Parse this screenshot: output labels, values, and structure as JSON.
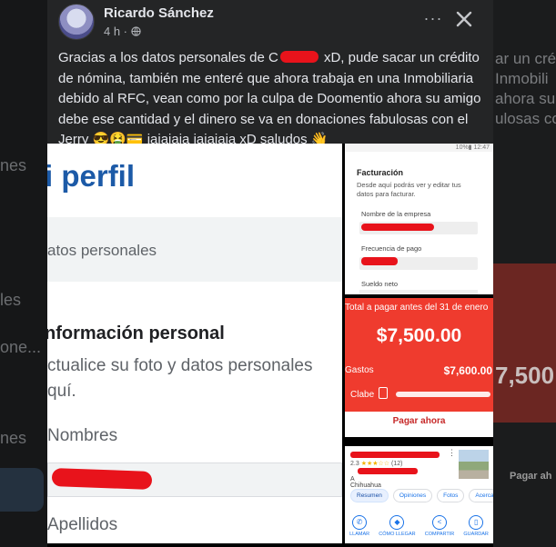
{
  "background": {
    "left_snippets": [
      "nes",
      "les",
      "one...",
      "nes"
    ],
    "right_snippets": [
      "ar un cré",
      "Inmobili",
      "ahora su",
      "ulosas co"
    ],
    "right_amount": "7,500",
    "right_pay": "Pagar ah"
  },
  "post": {
    "author": "Ricardo Sánchez",
    "time": "4 h ·",
    "more_label": "···",
    "text_before_redaction": "Gracias a los datos personales de C",
    "text_after_redaction": " xD, pude sacar un crédito de nómina, también me enteré que ahora trabaja en una Inmobiliaria debido al RFC, vean como por la culpa de Doomentio ahora su amigo debe ese cantidad y el dinero se va en donaciones fabulosas con el Jerry 😎🤮💳 jajajaja jajajaja xD saludos 👋"
  },
  "profile_image": {
    "title": "i perfil",
    "section": "atos personales",
    "heading": "nformación personal",
    "description_line1": "ctualice su foto y datos personales",
    "description_line2": "quí.",
    "label_first": "Nombres",
    "label_last": "Apellidos"
  },
  "billing_image": {
    "status": "10%▮ 12:47",
    "heading": "Facturación",
    "description": "Desde aquí podrás ver y editar tus datos para facturar.",
    "label_company": "Nombre de la empresa",
    "label_frequency": "Frecuencia de pago",
    "label_salary": "Sueldo neto"
  },
  "payment_image": {
    "due_label": "Total a pagar antes del 31 de enero",
    "amount": "$7,500.00",
    "expenses_label": "Gastos",
    "expenses_value": "$7,600.00",
    "clabe_label": "Clabe",
    "pay_button": "Pagar ahora"
  },
  "maps_image": {
    "more": "⋮",
    "rating": "2.3",
    "stars": "★★★☆☆",
    "reviews": "(12)",
    "city_prefix": "A",
    "city": "Chihuahua",
    "chips": [
      "Resumen",
      "Opiniones",
      "Fotos",
      "Acerca"
    ],
    "actions": [
      {
        "label": "LLAMAR",
        "icon": "phone-icon",
        "glyph": "✆"
      },
      {
        "label": "CÓMO LLEGAR",
        "icon": "directions-icon",
        "glyph": "◆"
      },
      {
        "label": "COMPARTIR",
        "icon": "share-icon",
        "glyph": "<"
      },
      {
        "label": "GUARDAR",
        "icon": "bookmark-icon",
        "glyph": "▯"
      }
    ]
  },
  "colors": {
    "card_bg": "#242526",
    "redaction": "#e8131b",
    "payment_red": "#ef3b2e",
    "profile_title_blue": "#1c5aa7"
  }
}
